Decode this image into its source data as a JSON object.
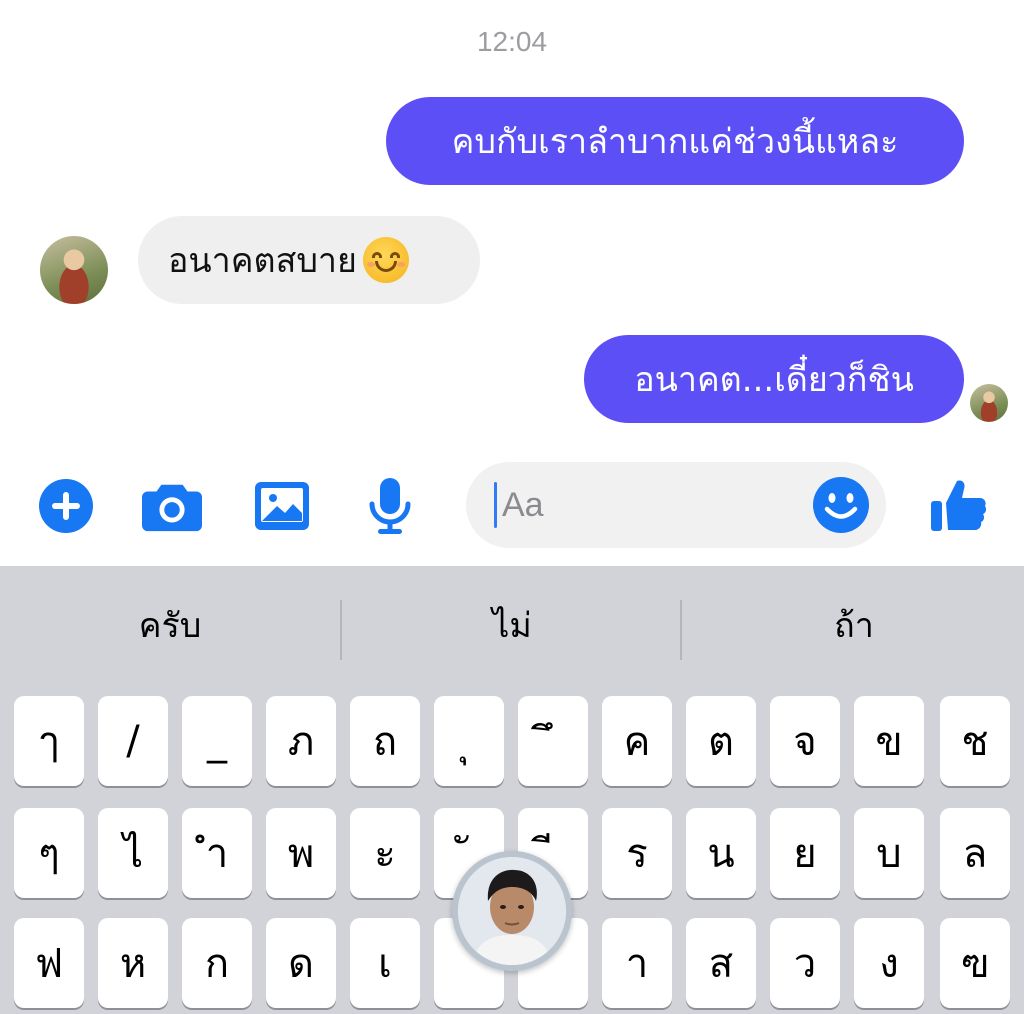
{
  "timestamp": "12:04",
  "messages": [
    {
      "direction": "outgoing",
      "text": "คบกับเราลำบากแค่ช่วงนี้แหละ"
    },
    {
      "direction": "incoming",
      "text": "อนาคตสบาย",
      "emoji": "smiling-face-emoji"
    },
    {
      "direction": "outgoing",
      "text": "อนาคต...เดี๋ยวก็ชิน"
    }
  ],
  "composer": {
    "placeholder": "Aa",
    "icons": [
      "plus-icon",
      "camera-icon",
      "gallery-icon",
      "microphone-icon",
      "smile-icon",
      "thumbs-up-icon"
    ]
  },
  "keyboard": {
    "suggestions": [
      "ครับ",
      "ไม่",
      "ถ้า"
    ],
    "rows": [
      [
        "ๅ",
        "/",
        "_",
        "ภ",
        "ถ",
        "ุ",
        "ึ",
        "ค",
        "ต",
        "จ",
        "ข",
        "ช"
      ],
      [
        "ๆ",
        "ไ",
        "ำ",
        "พ",
        "ะ",
        "ั",
        "ี",
        "ร",
        "น",
        "ย",
        "บ",
        "ล"
      ],
      [
        "ฟ",
        "ห",
        "ก",
        "ด",
        "เ",
        "",
        "",
        "า",
        "ส",
        "ว",
        "ง",
        "ฃ"
      ]
    ]
  },
  "colors": {
    "outgoing_bubble": "#5b4ff5",
    "incoming_bubble": "#efefef",
    "accent": "#1877f2",
    "keyboard_bg": "#d2d3d9"
  }
}
